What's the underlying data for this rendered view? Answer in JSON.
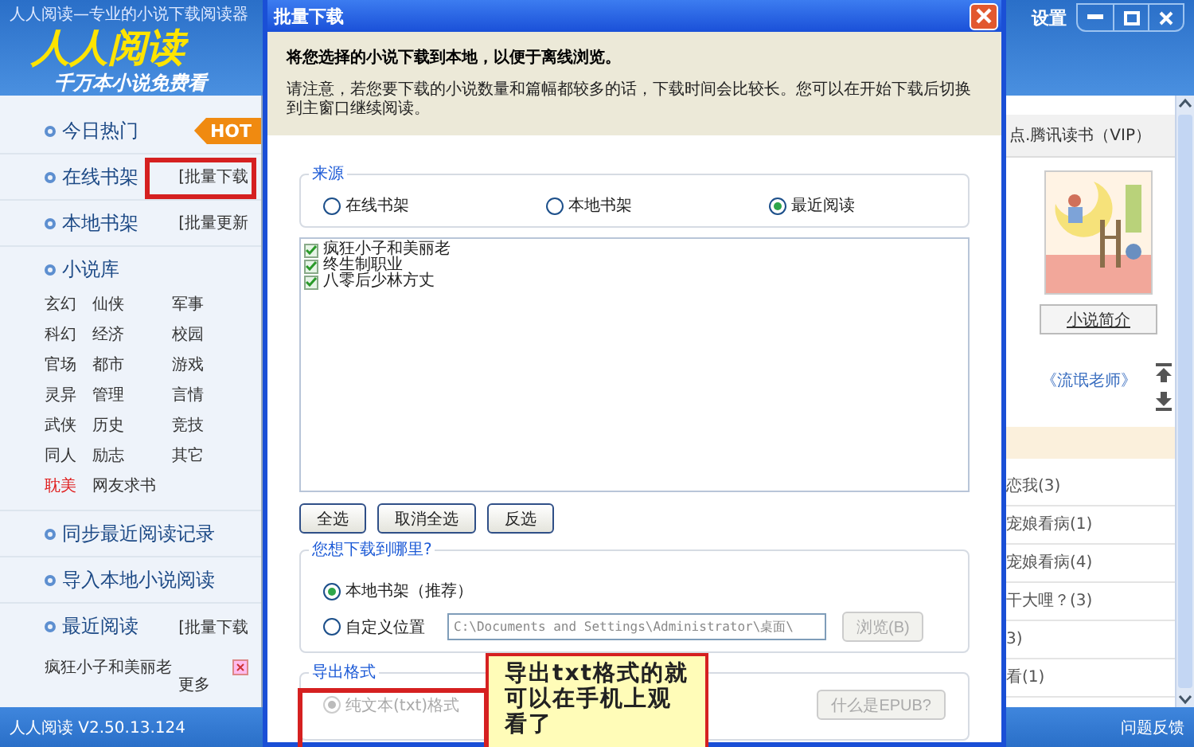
{
  "app": {
    "title": "人人阅读—专业的小说下载阅读器",
    "logo": "人人阅读",
    "slogan": "千万本小说免费看",
    "settings": "设置",
    "version": "人人阅读 V2.50.13.124",
    "feedback": "问题反馈"
  },
  "sidebar": {
    "sections": [
      {
        "label": "今日热门",
        "badge": "HOT"
      },
      {
        "label": "在线书架",
        "action": "[批量下载",
        "highlighted": true
      },
      {
        "label": "本地书架",
        "action": "[批量更新",
        "highlighted": false
      }
    ],
    "library": {
      "label": "小说库",
      "genres": [
        {
          "label": "玄幻",
          "color": "#333333"
        },
        {
          "label": "仙侠",
          "color": "#333333"
        },
        {
          "label": "军事",
          "color": "#333333"
        },
        {
          "label": "科幻",
          "color": "#333333"
        },
        {
          "label": "经济",
          "color": "#333333"
        },
        {
          "label": "校园",
          "color": "#333333"
        },
        {
          "label": "官场",
          "color": "#333333"
        },
        {
          "label": "都市",
          "color": "#333333"
        },
        {
          "label": "游戏",
          "color": "#333333"
        },
        {
          "label": "灵异",
          "color": "#333333"
        },
        {
          "label": "管理",
          "color": "#333333"
        },
        {
          "label": "言情",
          "color": "#333333"
        },
        {
          "label": "武侠",
          "color": "#333333"
        },
        {
          "label": "历史",
          "color": "#333333"
        },
        {
          "label": "竞技",
          "color": "#333333"
        },
        {
          "label": "同人",
          "color": "#333333"
        },
        {
          "label": "励志",
          "color": "#333333"
        },
        {
          "label": "其它",
          "color": "#333333"
        },
        {
          "label": "耽美",
          "color": "#e02020"
        },
        {
          "label": "网友求书",
          "color": "#333333"
        }
      ]
    },
    "links": [
      "同步最近阅读记录",
      "导入本地小说阅读"
    ],
    "recent": {
      "label": "最近阅读",
      "action": "[批量下载",
      "items": [
        "疯狂小子和美丽老"
      ],
      "more": "更多"
    }
  },
  "right_panel": {
    "heading": "点.腾讯读书（VIP）",
    "intro_button": "小说简介",
    "link": "《流氓老师》",
    "list": [
      "恋我(3)",
      "宠娘看病(1)",
      "宠娘看病(4)",
      "干大哩？(3)",
      "3)",
      "看(1)"
    ]
  },
  "dialog": {
    "title": "批量下载",
    "intro": "将您选择的小说下载到本地，以便于离线浏览。",
    "notice": "请注意，若您要下载的小说数量和篇幅都较多的话，下载时间会比较长。您可以在开始下载后切换到主窗口继续阅读。",
    "source": {
      "label": "来源",
      "options": [
        {
          "label": "在线书架",
          "selected": false
        },
        {
          "label": "本地书架",
          "selected": false
        },
        {
          "label": "最近阅读",
          "selected": true
        }
      ]
    },
    "books": [
      {
        "label": "疯狂小子和美丽老",
        "checked": true
      },
      {
        "label": "终生制职业",
        "checked": true
      },
      {
        "label": "八零后少林方丈",
        "checked": true
      }
    ],
    "buttons": [
      "全选",
      "取消全选",
      "反选"
    ],
    "destination": {
      "label": "您想下载到哪里?",
      "options": [
        {
          "label": "本地书架（推荐）",
          "selected": true
        },
        {
          "label": "自定义位置",
          "selected": false
        }
      ],
      "path": "C:\\Documents and Settings\\Administrator\\桌面\\",
      "browse": "浏览(B)",
      "browse_disabled": true
    },
    "format": {
      "label": "导出格式",
      "option": {
        "label": "纯文本(txt)格式",
        "selected": true,
        "disabled": true
      },
      "help": "什么是EPUB?"
    },
    "callout": "导出txt格式的就可以在手机上观看了"
  }
}
